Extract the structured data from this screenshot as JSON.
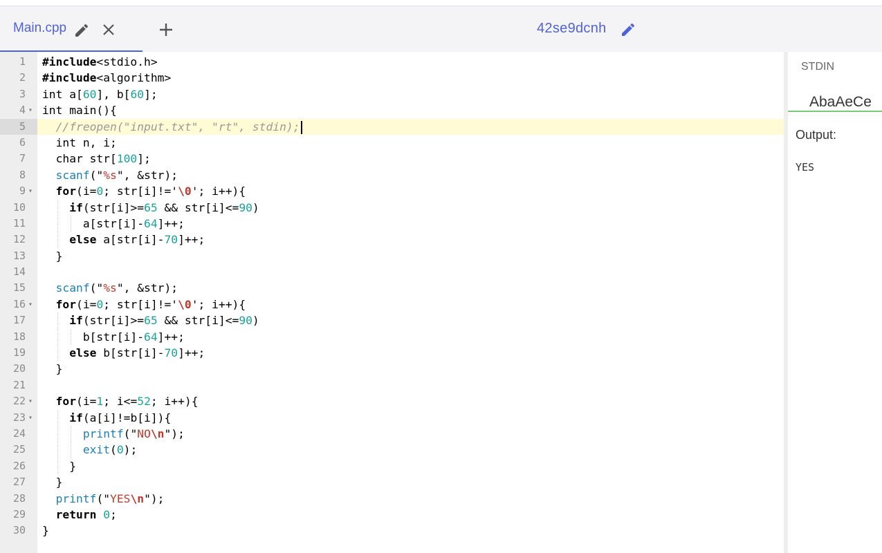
{
  "tabs": [
    {
      "label": "Main.cpp",
      "active": true,
      "icons": [
        "pencil-icon",
        "close-icon"
      ]
    }
  ],
  "add_tab_icon": "plus-icon",
  "project": {
    "name": "42se9dcnh",
    "icon": "pencil-icon"
  },
  "colors": {
    "accent": "#4f63d9",
    "stdin_underline": "#7ac97a",
    "active_line_bg": "#fffbd4",
    "gutter_bg": "#eeeeee",
    "keyword_fn": "#1a7fb5",
    "number": "#1aa39a",
    "string": "#c0392b",
    "comment": "#9a9a9a"
  },
  "editor": {
    "active_line": 5,
    "lines": [
      {
        "n": "1",
        "text": "#include<stdio.h>"
      },
      {
        "n": "2",
        "text": "#include<algorithm>"
      },
      {
        "n": "3",
        "text": "int a[60], b[60];"
      },
      {
        "n": "4",
        "text": "int main(){",
        "fold": true
      },
      {
        "n": "5",
        "text": "  //freopen(\"input.txt\", \"rt\", stdin);"
      },
      {
        "n": "6",
        "text": "  int n, i;"
      },
      {
        "n": "7",
        "text": "  char str[100];"
      },
      {
        "n": "8",
        "text": "  scanf(\"%s\", &str);"
      },
      {
        "n": "9",
        "text": "  for(i=0; str[i]!='\\0'; i++){",
        "fold": true
      },
      {
        "n": "10",
        "text": "    if(str[i]>=65 && str[i]<=90)"
      },
      {
        "n": "11",
        "text": "      a[str[i]-64]++;"
      },
      {
        "n": "12",
        "text": "    else a[str[i]-70]++;"
      },
      {
        "n": "13",
        "text": "  }"
      },
      {
        "n": "14",
        "text": ""
      },
      {
        "n": "15",
        "text": "  scanf(\"%s\", &str);"
      },
      {
        "n": "16",
        "text": "  for(i=0; str[i]!='\\0'; i++){",
        "fold": true
      },
      {
        "n": "17",
        "text": "    if(str[i]>=65 && str[i]<=90)"
      },
      {
        "n": "18",
        "text": "      b[str[i]-64]++;"
      },
      {
        "n": "19",
        "text": "    else b[str[i]-70]++;"
      },
      {
        "n": "20",
        "text": "  }"
      },
      {
        "n": "21",
        "text": ""
      },
      {
        "n": "22",
        "text": "  for(i=1; i<=52; i++){",
        "fold": true
      },
      {
        "n": "23",
        "text": "    if(a[i]!=b[i]){",
        "fold": true
      },
      {
        "n": "24",
        "text": "      printf(\"NO\\n\");"
      },
      {
        "n": "25",
        "text": "      exit(0);"
      },
      {
        "n": "26",
        "text": "    }"
      },
      {
        "n": "27",
        "text": "  }"
      },
      {
        "n": "28",
        "text": "  printf(\"YES\\n\");"
      },
      {
        "n": "29",
        "text": "  return 0;"
      },
      {
        "n": "30",
        "text": "}"
      }
    ]
  },
  "stdin": {
    "label": "STDIN",
    "value": "AbaAeCe"
  },
  "output": {
    "label": "Output:",
    "value": "YES"
  }
}
